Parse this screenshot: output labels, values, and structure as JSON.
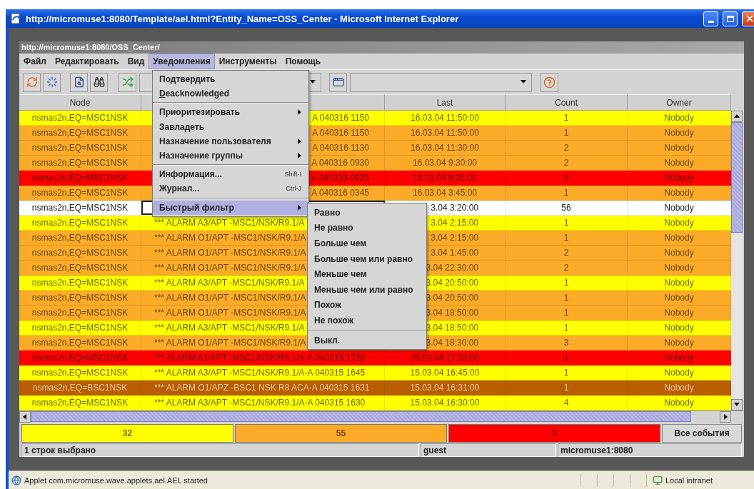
{
  "window": {
    "title": "http://micromuse1:8080/Template/ael.html?Entity_Name=OSS_Center - Microsoft Internet Explorer"
  },
  "applet": {
    "title": "http://micromuse1:8080/OSS_Center/",
    "menu": [
      {
        "label": "Файл",
        "selected": false
      },
      {
        "label": "Редактировать",
        "selected": false
      },
      {
        "label": "Вид",
        "selected": false
      },
      {
        "label": "Уведомления",
        "selected": true
      },
      {
        "label": "Инструменты",
        "selected": false
      },
      {
        "label": "Помощь",
        "selected": false
      }
    ],
    "dropdown": [
      {
        "kind": "item",
        "label": "Подтвердить",
        "submenu": false,
        "mnemonic": false,
        "selected": false
      },
      {
        "kind": "item",
        "label": "Deacknowledged",
        "submenu": false,
        "mnemonic": true,
        "selected": false
      },
      {
        "kind": "separator"
      },
      {
        "kind": "item",
        "label": "Приоритезировать",
        "submenu": true,
        "mnemonic": false,
        "selected": false
      },
      {
        "kind": "item",
        "label": "Завладеть",
        "submenu": false,
        "mnemonic": false,
        "selected": false
      },
      {
        "kind": "item",
        "label": "Назначение пользователя",
        "submenu": true,
        "mnemonic": false,
        "selected": false
      },
      {
        "kind": "item",
        "label": "Назначение группы",
        "submenu": true,
        "mnemonic": false,
        "selected": false
      },
      {
        "kind": "separator"
      },
      {
        "kind": "item",
        "label": "Информация...",
        "shortcut": "Shift-I",
        "submenu": false,
        "mnemonic": false,
        "selected": false
      },
      {
        "kind": "item",
        "label": "Журнал...",
        "shortcut": "Ctrl-J",
        "submenu": false,
        "mnemonic": false,
        "selected": false
      },
      {
        "kind": "separator"
      },
      {
        "kind": "item",
        "label": "Быстрый фильтр",
        "submenu": true,
        "mnemonic": false,
        "selected": true
      }
    ],
    "submenu": [
      {
        "kind": "item",
        "label": "Равно"
      },
      {
        "kind": "item",
        "label": "Не равно"
      },
      {
        "kind": "item",
        "label": "Больше чем"
      },
      {
        "kind": "item",
        "label": "Больше чем или равно"
      },
      {
        "kind": "item",
        "label": "Меньше чем"
      },
      {
        "kind": "item",
        "label": "Меньше чем или равно"
      },
      {
        "kind": "item",
        "label": "Похож"
      },
      {
        "kind": "item",
        "label": "Не похож"
      },
      {
        "kind": "separator"
      },
      {
        "kind": "item",
        "label": "Выкл."
      }
    ],
    "table": {
      "columns": [
        "Node",
        "Last",
        "Count",
        "Owner"
      ],
      "rows": [
        {
          "kind": "menu",
          "node": "nsmas2n,EQ=MSC1NSK",
          "column_2": "A 040316 1150",
          "last": "16.03.04 11:50:00",
          "count": "1",
          "owner": "Nobody",
          "color": "#ffff00",
          "selected": false
        },
        {
          "kind": "menu",
          "node": "nsmas2n,EQ=MSC1NSK",
          "column_2": "A 040316 1150",
          "last": "16.03.04 11:50:00",
          "count": "1",
          "owner": "Nobody",
          "color": "#fbab28",
          "selected": false
        },
        {
          "kind": "menu",
          "node": "nsmas2n,EQ=MSC1NSK",
          "column_2": "A 040316 1130",
          "last": "16.03.04 11:30:00",
          "count": "2",
          "owner": "Nobody",
          "color": "#fbab28",
          "selected": false
        },
        {
          "kind": "menu",
          "node": "nsmas2n,EQ=MSC1NSK",
          "column_2": "A 040316 0930",
          "last": "16.03.04 9:30:00",
          "count": "2",
          "owner": "Nobody",
          "color": "#fbab28",
          "selected": false
        },
        {
          "kind": "menu",
          "node": "nsmas2n,EQ=MSC1NSK",
          "column_2": "A 040316 0925",
          "last": "16.03.04 9:25:00",
          "count": "3",
          "owner": "Nobody",
          "color": "#ff0000",
          "selected": false
        },
        {
          "kind": "menu",
          "node": "nsmas2n,EQ=MSC1NSK",
          "column_2": "A 040316 0345",
          "last": "16.03.04 3:45:00",
          "count": "1",
          "owner": "Nobody",
          "color": "#fbab28",
          "selected": false
        },
        {
          "kind": "submenu",
          "node": "nsmas2n,EQ=MSC1NSK",
          "last": "3.04 3:20:00",
          "count": "56",
          "owner": "Nobody",
          "selected": true
        },
        {
          "kind": "submenu",
          "node": "nsmas2n,EQ=MSC1NSK",
          "column_2": "*** ALARM A3/APT -MSC1/NSK/R9.1/A",
          "last": "3.04 2:15:00",
          "count": "1",
          "owner": "Nobody",
          "color": "#ffff00",
          "selected": false
        },
        {
          "kind": "submenu",
          "node": "nsmas2n,EQ=MSC1NSK",
          "column_2": "*** ALARM O1/APT -MSC1/NSK/R9.1/A",
          "last": "3.04 2:15:00",
          "count": "1",
          "owner": "Nobody",
          "color": "#fbab28",
          "selected": false
        },
        {
          "kind": "submenu",
          "node": "nsmas2n,EQ=MSC1NSK",
          "column_2": "*** ALARM O1/APT -MSC1/NSK/R9.1/A",
          "last": "3.04 1:45:00",
          "count": "2",
          "owner": "Nobody",
          "color": "#fbab28",
          "selected": false
        },
        {
          "kind": "submenu",
          "node": "nsmas2n,EQ=MSC1NSK",
          "column_2": "*** ALARM O1/APT -MSC1/NSK/R9.1/A",
          "last": "3.04 22:30:00",
          "count": "2",
          "owner": "Nobody",
          "color": "#fbab28",
          "selected": false
        },
        {
          "kind": "submenu",
          "node": "nsmas2n,EQ=MSC1NSK",
          "column_2": "*** ALARM A3/APT -MSC1/NSK/R9.1/A",
          "last": "3.04 20:50:00",
          "count": "1",
          "owner": "Nobody",
          "color": "#ffff00",
          "selected": false
        },
        {
          "kind": "submenu",
          "node": "nsmas2n,EQ=MSC1NSK",
          "column_2": "*** ALARM O1/APT -MSC1/NSK/R9.1/A",
          "last": "3.04 20:50:00",
          "count": "1",
          "owner": "Nobody",
          "color": "#fbab28",
          "selected": false
        },
        {
          "kind": "submenu",
          "node": "nsmas2n,EQ=MSC1NSK",
          "column_2": "*** ALARM O1/APT -MSC1/NSK/R9.1/A",
          "last": "3.04 18:50:00",
          "count": "1",
          "owner": "Nobody",
          "color": "#fbab28",
          "selected": false
        },
        {
          "kind": "submenu",
          "node": "nsmas2n,EQ=MSC1NSK",
          "column_2": "*** ALARM A3/APT -MSC1/NSK/R9.1/A",
          "last": "3.04 18:50:00",
          "count": "1",
          "owner": "Nobody",
          "color": "#ffff00",
          "selected": false
        },
        {
          "kind": "submenu",
          "node": "nsmas2n,EQ=MSC1NSK",
          "column_2": "*** ALARM O1/APT -MSC1/NSK/R9.1/A",
          "last": "3.04 18:30:00",
          "count": "3",
          "owner": "Nobody",
          "color": "#fbab28",
          "selected": false
        },
        {
          "kind": "plain",
          "node": "nsmas2n,EQ=MSC1NSK",
          "column_2": "*** ALARM A1/APT -MSC1/NSK/R9.1/A-A 040315 1728",
          "last": "15.03.04 17:28:00",
          "count": "1",
          "owner": "Nobody",
          "color": "#ff0000",
          "selected": false
        },
        {
          "kind": "plain",
          "node": "nsmas2n,EQ=MSC1NSK",
          "column_2": "*** ALARM A3/APT -MSC1/NSK/R9.1/A-A 040315 1645",
          "last": "15.03.04 16:45:00",
          "count": "1",
          "owner": "Nobody",
          "color": "#ffff00",
          "selected": false
        },
        {
          "kind": "plain",
          "node": "nsmas2n,EQ=BSC1NSK",
          "column_2": "*** ALARM O1/APZ -BSC1 NSK R8 ACA-A 040315 1631",
          "last": "15.03.04 16:31:00",
          "count": "1",
          "owner": "Nobody",
          "color": "#b85e00",
          "selected": false
        },
        {
          "kind": "plain",
          "node": "nsmas2n,EQ=MSC1NSK",
          "column_2": "*** ALARM A3/APT -MSC1/NSK/R9.1/A-A 040315 1630",
          "last": "15.03.04 16:30:00",
          "count": "4",
          "owner": "Nobody",
          "color": "#ffff00",
          "selected": false
        }
      ]
    },
    "counts": [
      {
        "label": "32",
        "color": "#ffff00"
      },
      {
        "label": "55",
        "color": "#fbab28"
      },
      {
        "label": "3",
        "color": "#ff0000"
      }
    ],
    "all_events_button": "Все события",
    "status": {
      "selection": "1 строк выбрано",
      "user": "guest",
      "server": "micromuse1:8080"
    }
  },
  "status_bar": {
    "message": "Applet com.micromuse.wave.applets.ael.AEL started",
    "zone": "Local intranet"
  }
}
